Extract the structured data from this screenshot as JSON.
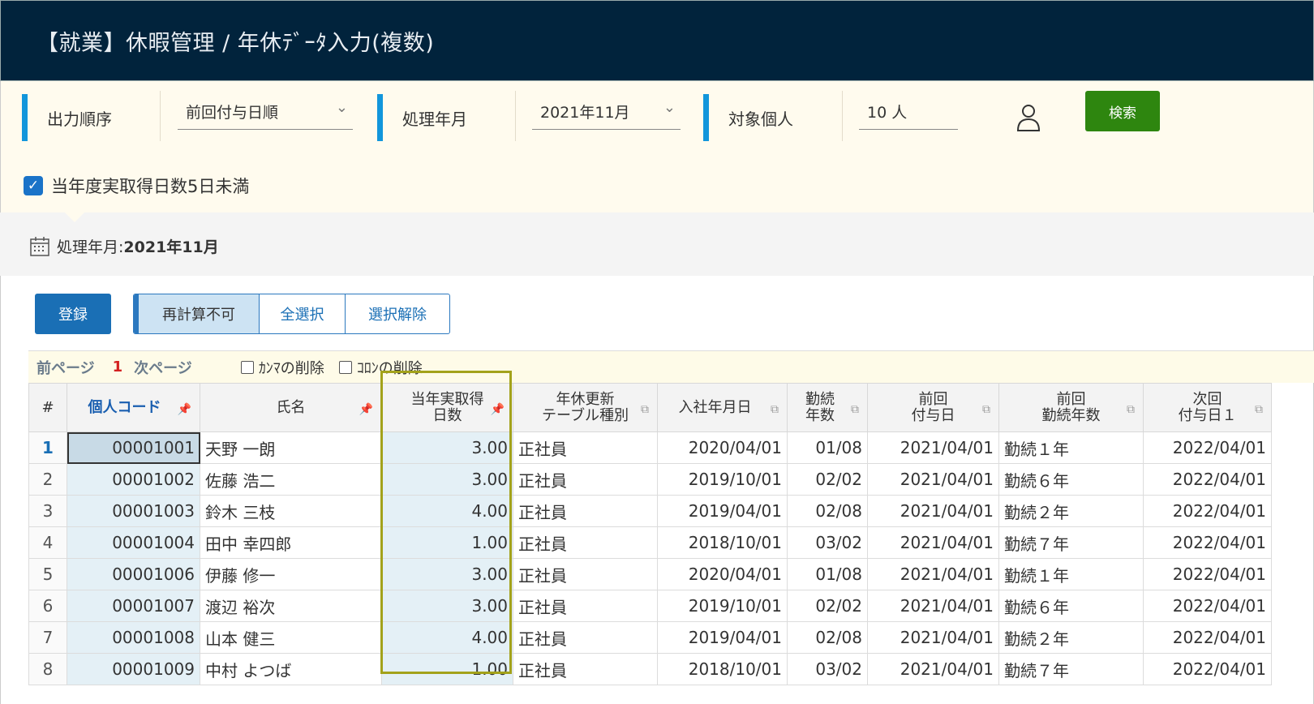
{
  "title": "【就業】休暇管理 / 年休ﾃﾞｰﾀ入力(複数)",
  "filters": {
    "order_label": "出力順序",
    "order_value": "前回付与日順",
    "period_label": "処理年月",
    "period_value": "2021年11月",
    "target_label": "対象個人",
    "target_value": "10 人",
    "search_label": "検索",
    "checkbox_label": "当年度実取得日数5日未満"
  },
  "processing": {
    "label": "処理年月:",
    "value": "2021年11月"
  },
  "toolbar": {
    "register": "登録",
    "recalc": "再計算不可",
    "select_all": "全選択",
    "deselect": "選択解除"
  },
  "pager": {
    "prev": "前ページ",
    "current": "1",
    "next": "次ページ",
    "comma_label": "ｶﾝﾏの削除",
    "colon_label": "ｺﾛﾝの削除"
  },
  "table": {
    "headers": {
      "index": "#",
      "code": "個人コード",
      "name": "氏名",
      "days_1": "当年実取得",
      "days_2": "日数",
      "table_type_1": "年休更新",
      "table_type_2": "テーブル種別",
      "hire_date": "入社年月日",
      "service_1": "勤続",
      "service_2": "年数",
      "prev_grant_1": "前回",
      "prev_grant_2": "付与日",
      "prev_service_1": "前回",
      "prev_service_2": "勤続年数",
      "next_grant_1": "次回",
      "next_grant_2": "付与日１"
    },
    "rows": [
      {
        "no": "1",
        "code": "00001001",
        "name": "天野 一朗",
        "days": "3.00",
        "type": "正社員",
        "hire": "2020/04/01",
        "service": "01/08",
        "prev_grant": "2021/04/01",
        "prev_service": "勤続１年",
        "next_grant": "2022/04/01"
      },
      {
        "no": "2",
        "code": "00001002",
        "name": "佐藤 浩二",
        "days": "3.00",
        "type": "正社員",
        "hire": "2019/10/01",
        "service": "02/02",
        "prev_grant": "2021/04/01",
        "prev_service": "勤続６年",
        "next_grant": "2022/04/01"
      },
      {
        "no": "3",
        "code": "00001003",
        "name": "鈴木 三枝",
        "days": "4.00",
        "type": "正社員",
        "hire": "2019/04/01",
        "service": "02/08",
        "prev_grant": "2021/04/01",
        "prev_service": "勤続２年",
        "next_grant": "2022/04/01"
      },
      {
        "no": "4",
        "code": "00001004",
        "name": "田中 幸四郎",
        "days": "1.00",
        "type": "正社員",
        "hire": "2018/10/01",
        "service": "03/02",
        "prev_grant": "2021/04/01",
        "prev_service": "勤続７年",
        "next_grant": "2022/04/01"
      },
      {
        "no": "5",
        "code": "00001006",
        "name": "伊藤 修一",
        "days": "3.00",
        "type": "正社員",
        "hire": "2020/04/01",
        "service": "01/08",
        "prev_grant": "2021/04/01",
        "prev_service": "勤続１年",
        "next_grant": "2022/04/01"
      },
      {
        "no": "6",
        "code": "00001007",
        "name": "渡辺 裕次",
        "days": "3.00",
        "type": "正社員",
        "hire": "2019/10/01",
        "service": "02/02",
        "prev_grant": "2021/04/01",
        "prev_service": "勤続６年",
        "next_grant": "2022/04/01"
      },
      {
        "no": "7",
        "code": "00001008",
        "name": "山本 健三",
        "days": "4.00",
        "type": "正社員",
        "hire": "2019/04/01",
        "service": "02/08",
        "prev_grant": "2021/04/01",
        "prev_service": "勤続２年",
        "next_grant": "2022/04/01"
      },
      {
        "no": "8",
        "code": "00001009",
        "name": "中村 よつば",
        "days": "1.00",
        "type": "正社員",
        "hire": "2018/10/01",
        "service": "03/02",
        "prev_grant": "2021/04/01",
        "prev_service": "勤続７年",
        "next_grant": "2022/04/01"
      }
    ]
  },
  "colors": {
    "header_bg": "#01233c",
    "filter_bg": "#fffbee",
    "accent_blue": "#1296db",
    "search_green": "#2e860f",
    "register_blue": "#1a6fb5",
    "highlight_olive": "#a3a21b",
    "selected_cell": "#c8dae6"
  },
  "icons": {
    "person": "person-icon",
    "calendar": "calendar-icon",
    "pin": "pin-icon",
    "chevron": "chevron-down-icon",
    "check": "check-icon"
  }
}
